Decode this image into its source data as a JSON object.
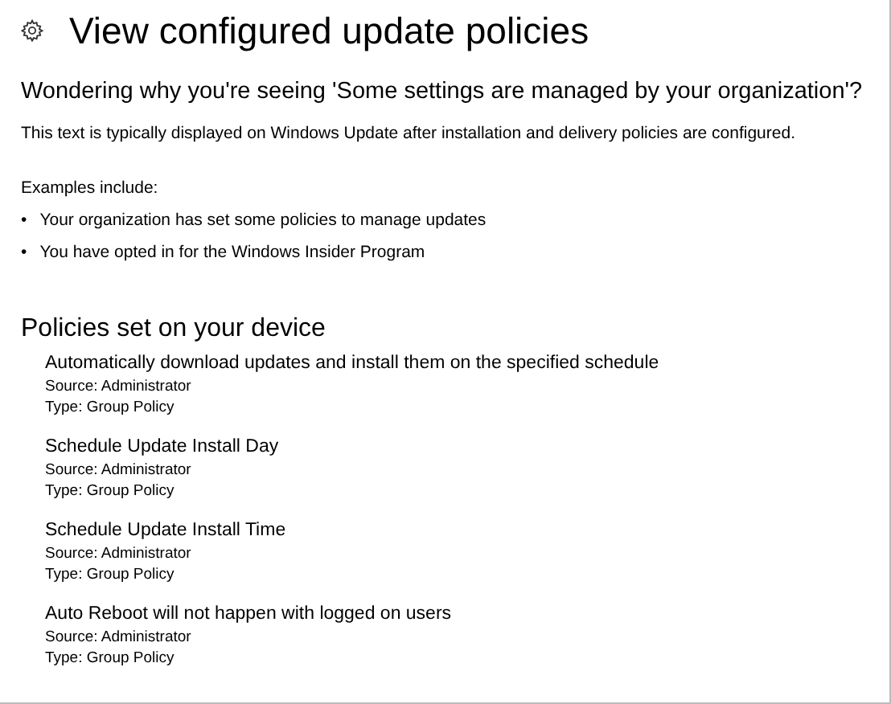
{
  "page": {
    "title": "View configured update policies"
  },
  "intro": {
    "heading": "Wondering why you're seeing 'Some settings are managed by your organization'?",
    "description": "This text is typically displayed on Windows Update after installation and delivery policies are configured.",
    "examples_label": "Examples include:",
    "examples": [
      {
        "bullet": "•",
        "text": "Your organization has set some policies to manage updates"
      },
      {
        "bullet": "•",
        "text": "You have opted in for the Windows Insider Program"
      }
    ]
  },
  "policies": {
    "heading": "Policies set on your device",
    "items": [
      {
        "name": "Automatically download updates and install them on the specified schedule",
        "source": "Source: Administrator",
        "type": "Type: Group Policy"
      },
      {
        "name": "Schedule Update Install Day",
        "source": "Source: Administrator",
        "type": "Type: Group Policy"
      },
      {
        "name": "Schedule Update Install Time",
        "source": "Source: Administrator",
        "type": "Type: Group Policy"
      },
      {
        "name": "Auto Reboot will not happen with logged on users",
        "source": "Source: Administrator",
        "type": "Type: Group Policy"
      }
    ]
  }
}
